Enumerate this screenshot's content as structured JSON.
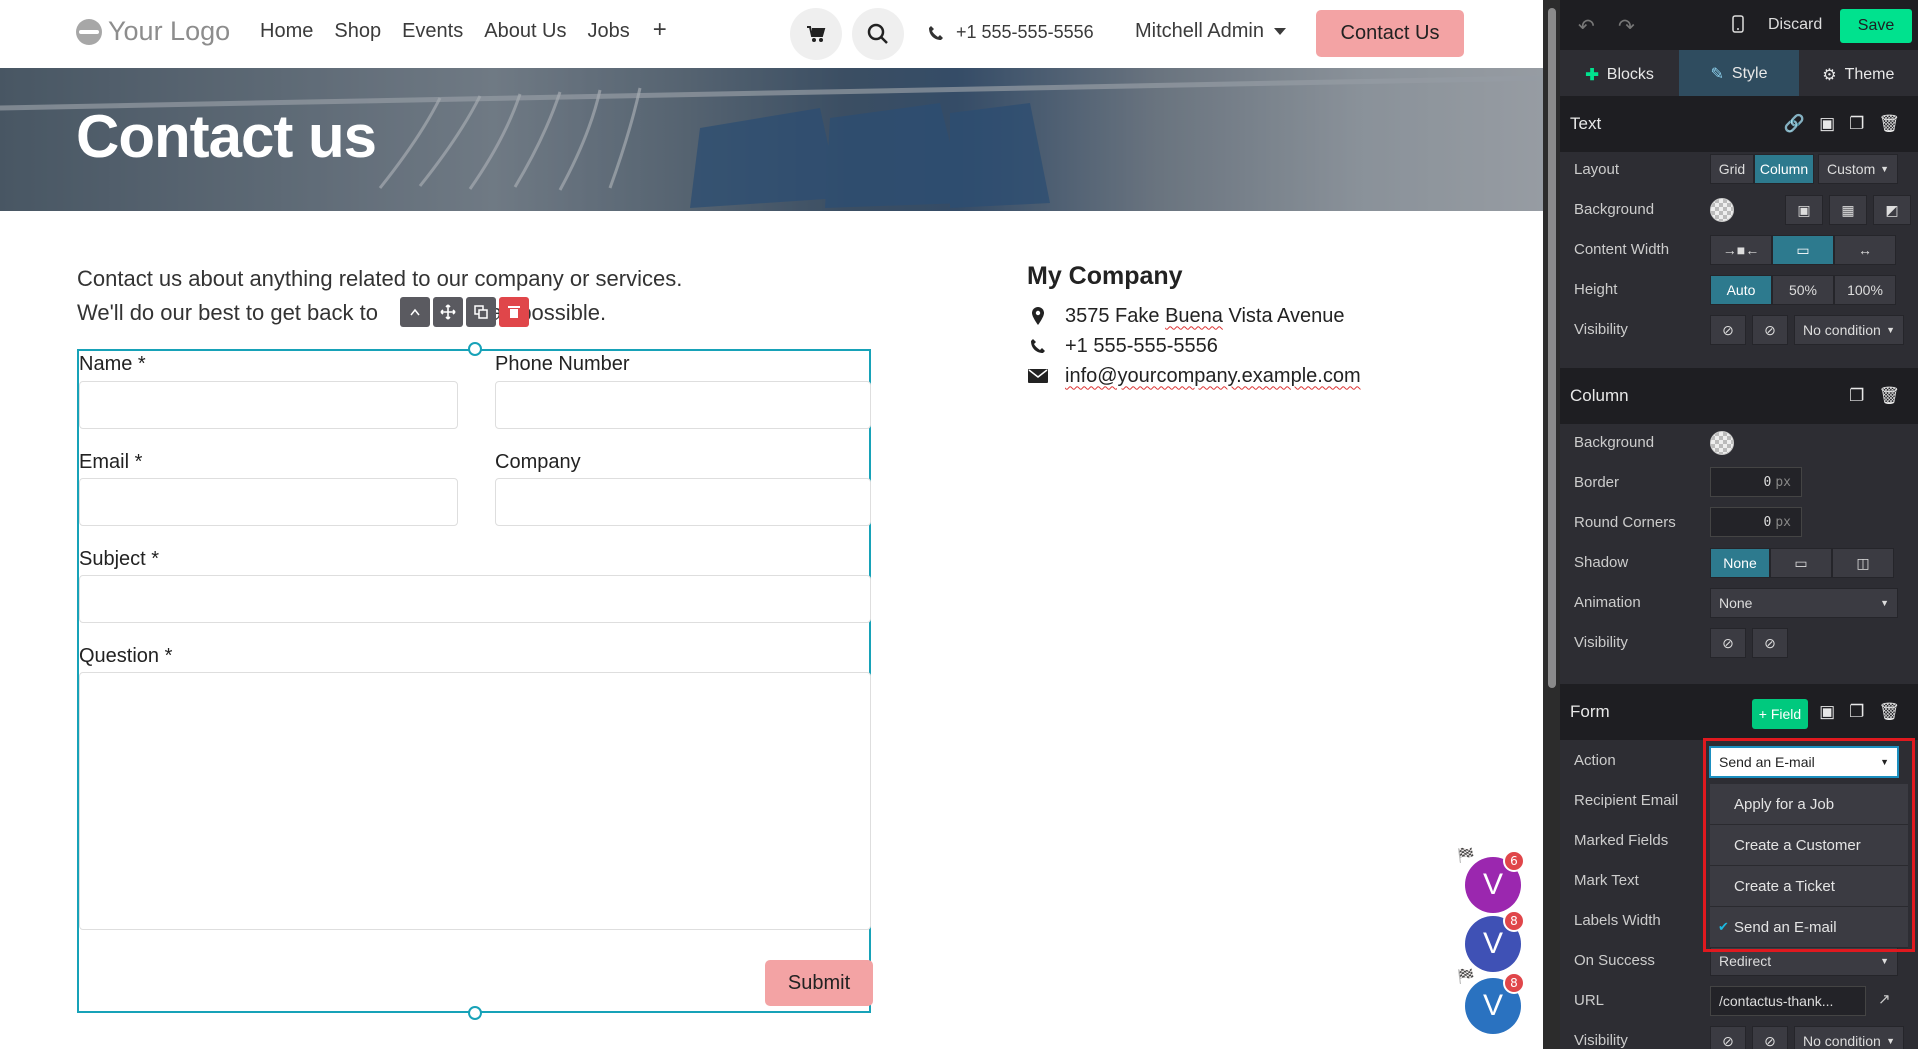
{
  "header": {
    "logo_text": "Your Logo",
    "nav": [
      "Home",
      "Shop",
      "Events",
      "About Us",
      "Jobs"
    ],
    "nav_add": "+",
    "phone": "+1 555-555-5556",
    "user": "Mitchell Admin",
    "contact_button": "Contact Us"
  },
  "banner": {
    "title": "Contact us"
  },
  "intro": {
    "line1": "Contact us about anything related to our company or services.",
    "line2_a": "We'll do our best to get back to",
    "line2_b": "as possible."
  },
  "form": {
    "name_label": "Name *",
    "phone_label": "Phone Number",
    "email_label": "Email *",
    "company_label": "Company",
    "subject_label": "Subject *",
    "question_label": "Question *",
    "submit_label": "Submit"
  },
  "company": {
    "name": "My Company",
    "address_a": "3575 Fake ",
    "address_b": "Buena",
    "address_c": " Vista Avenue",
    "phone": "+1 555-555-5556",
    "email": "info@yourcompany.example.com"
  },
  "avatars": [
    {
      "letter": "V",
      "badge": "6",
      "color": "#9b27af"
    },
    {
      "letter": "V",
      "badge": "8",
      "color": "#3f51b5"
    },
    {
      "letter": "V",
      "badge": "8",
      "color": "#2a72c0"
    }
  ],
  "editor": {
    "discard": "Discard",
    "save": "Save",
    "tabs": [
      "Blocks",
      "Style",
      "Theme"
    ],
    "text_section": {
      "title": "Text",
      "layout_label": "Layout",
      "layout_options": [
        "Grid",
        "Column",
        "Custom"
      ],
      "background_label": "Background",
      "content_width_label": "Content Width",
      "height_label": "Height",
      "height_options": [
        "Auto",
        "50%",
        "100%"
      ],
      "visibility_label": "Visibility",
      "visibility_value": "No condition"
    },
    "column_section": {
      "title": "Column",
      "background_label": "Background",
      "border_label": "Border",
      "border_value": "0",
      "round_label": "Round Corners",
      "round_value": "0",
      "unit": "px",
      "shadow_label": "Shadow",
      "shadow_value": "None",
      "animation_label": "Animation",
      "animation_value": "None",
      "visibility_label": "Visibility"
    },
    "form_section": {
      "title": "Form",
      "add_field": "+ Field",
      "action_label": "Action",
      "action_value": "Send an E-mail",
      "action_options": [
        "Apply for a Job",
        "Create a Customer",
        "Create a Ticket",
        "Send an E-mail"
      ],
      "recipient_label": "Recipient Email",
      "marked_label": "Marked Fields",
      "mark_text_label": "Mark Text",
      "labels_width_label": "Labels Width",
      "on_success_label": "On Success",
      "on_success_value": "Redirect",
      "url_label": "URL",
      "url_value": "/contactus-thank...",
      "visibility_label": "Visibility",
      "visibility_value": "No condition"
    }
  }
}
